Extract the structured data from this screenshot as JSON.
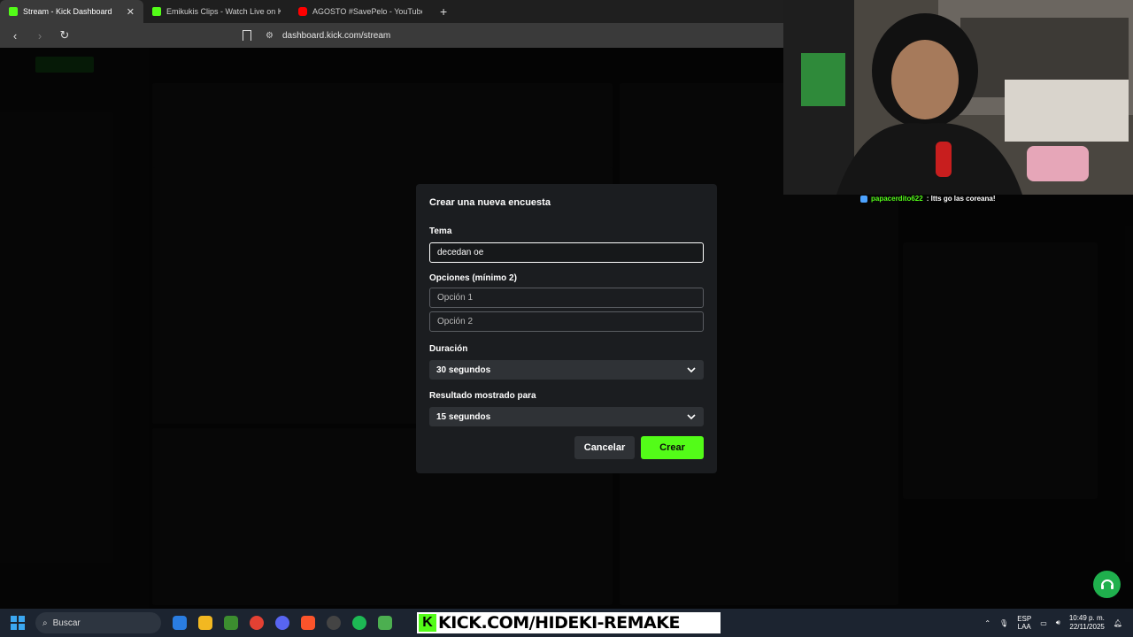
{
  "browser": {
    "tabs": [
      {
        "title": "Stream - Kick Dashboard",
        "favicon_color": "#53fc18"
      },
      {
        "title": "Emikukis Clips - Watch Live on Kick",
        "favicon_color": "#53fc18"
      },
      {
        "title": "AGOSTO #SavePelo - YouTube",
        "favicon_color": "#ff0000"
      }
    ],
    "new_tab": "+",
    "close": "✕",
    "url": "dashboard.kick.com/stream"
  },
  "modal": {
    "title": "Crear una nueva encuesta",
    "topic_label": "Tema",
    "topic_value": "decedan oe",
    "options_label": "Opciones (mínimo 2)",
    "option1_placeholder": "Opción 1",
    "option2_placeholder": "Opción 2",
    "duration_label": "Duración",
    "duration_value": "30 segundos",
    "result_label": "Resultado mostrado para",
    "result_value": "15 segundos",
    "cancel_label": "Cancelar",
    "create_label": "Crear"
  },
  "overlay_chat": {
    "user": "papacerdito622",
    "message": ": Itts go las coreana!"
  },
  "taskbar": {
    "search_label": "Buscar",
    "banner_text": "KICK.COM/HIDEKI-REMAKE",
    "banner_k": "K",
    "lang_top": "ESP",
    "lang_bottom": "LAA",
    "time": "10:49 p. m.",
    "date": "22/11/2025"
  },
  "colors": {
    "accent": "#53fc18",
    "modal_bg": "#1b1d20",
    "select_bg": "#2f3236"
  }
}
